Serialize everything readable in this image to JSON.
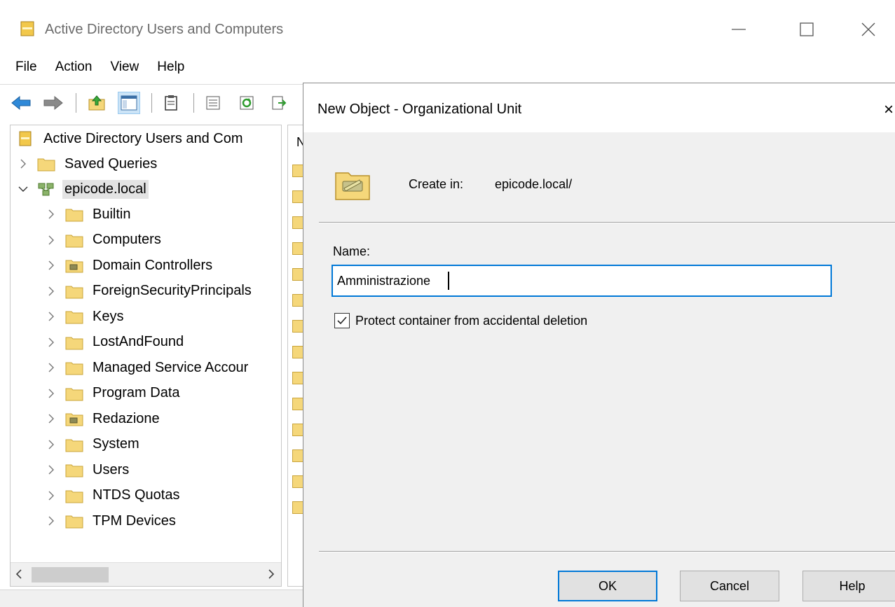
{
  "window": {
    "title": "Active Directory Users and Computers"
  },
  "menu": [
    "File",
    "Action",
    "View",
    "Help"
  ],
  "toolbar": {
    "icons": [
      "back-arrow-icon",
      "forward-arrow-icon",
      "up-folder-icon",
      "show-hide-tree-icon",
      "properties-icon",
      "export-list-icon",
      "refresh-icon",
      "export-icon"
    ]
  },
  "tree": {
    "root": "Active Directory Users and Com",
    "saved_queries": "Saved Queries",
    "domain": "epicode.local",
    "children": [
      {
        "label": "Builtin",
        "type": "container"
      },
      {
        "label": "Computers",
        "type": "container"
      },
      {
        "label": "Domain Controllers",
        "type": "ou"
      },
      {
        "label": "ForeignSecurityPrincipals",
        "type": "container"
      },
      {
        "label": "Keys",
        "type": "container"
      },
      {
        "label": "LostAndFound",
        "type": "container"
      },
      {
        "label": "Managed Service Accour",
        "type": "container"
      },
      {
        "label": "Program Data",
        "type": "container"
      },
      {
        "label": "Redazione",
        "type": "ou"
      },
      {
        "label": "System",
        "type": "container"
      },
      {
        "label": "Users",
        "type": "container"
      },
      {
        "label": "NTDS Quotas",
        "type": "container"
      },
      {
        "label": "TPM Devices",
        "type": "container"
      }
    ]
  },
  "list_pane": {
    "header_fragment": "N"
  },
  "dialog": {
    "title": "New Object - Organizational Unit",
    "close_glyph": "×",
    "create_in_label": "Create in:",
    "create_in_value": "epicode.local/",
    "name_label": "Name:",
    "name_value": "Amministrazione",
    "protect_label": "Protect container from accidental deletion",
    "protect_checked": true,
    "buttons": {
      "ok": "OK",
      "cancel": "Cancel",
      "help": "Help"
    }
  },
  "colors": {
    "accent": "#0078d7",
    "folder": "#f5d77a",
    "selection": "#e3e3e3"
  }
}
